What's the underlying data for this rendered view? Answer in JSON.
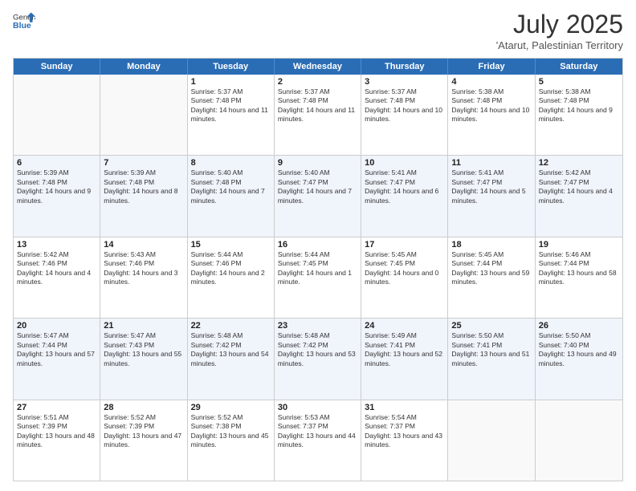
{
  "logo": {
    "general": "General",
    "blue": "Blue"
  },
  "title": "July 2025",
  "location": "'Atarut, Palestinian Territory",
  "days_of_week": [
    "Sunday",
    "Monday",
    "Tuesday",
    "Wednesday",
    "Thursday",
    "Friday",
    "Saturday"
  ],
  "weeks": [
    [
      {
        "day": "",
        "sunrise": "",
        "sunset": "",
        "daylight": ""
      },
      {
        "day": "",
        "sunrise": "",
        "sunset": "",
        "daylight": ""
      },
      {
        "day": "1",
        "sunrise": "Sunrise: 5:37 AM",
        "sunset": "Sunset: 7:48 PM",
        "daylight": "Daylight: 14 hours and 11 minutes."
      },
      {
        "day": "2",
        "sunrise": "Sunrise: 5:37 AM",
        "sunset": "Sunset: 7:48 PM",
        "daylight": "Daylight: 14 hours and 11 minutes."
      },
      {
        "day": "3",
        "sunrise": "Sunrise: 5:37 AM",
        "sunset": "Sunset: 7:48 PM",
        "daylight": "Daylight: 14 hours and 10 minutes."
      },
      {
        "day": "4",
        "sunrise": "Sunrise: 5:38 AM",
        "sunset": "Sunset: 7:48 PM",
        "daylight": "Daylight: 14 hours and 10 minutes."
      },
      {
        "day": "5",
        "sunrise": "Sunrise: 5:38 AM",
        "sunset": "Sunset: 7:48 PM",
        "daylight": "Daylight: 14 hours and 9 minutes."
      }
    ],
    [
      {
        "day": "6",
        "sunrise": "Sunrise: 5:39 AM",
        "sunset": "Sunset: 7:48 PM",
        "daylight": "Daylight: 14 hours and 9 minutes."
      },
      {
        "day": "7",
        "sunrise": "Sunrise: 5:39 AM",
        "sunset": "Sunset: 7:48 PM",
        "daylight": "Daylight: 14 hours and 8 minutes."
      },
      {
        "day": "8",
        "sunrise": "Sunrise: 5:40 AM",
        "sunset": "Sunset: 7:48 PM",
        "daylight": "Daylight: 14 hours and 7 minutes."
      },
      {
        "day": "9",
        "sunrise": "Sunrise: 5:40 AM",
        "sunset": "Sunset: 7:47 PM",
        "daylight": "Daylight: 14 hours and 7 minutes."
      },
      {
        "day": "10",
        "sunrise": "Sunrise: 5:41 AM",
        "sunset": "Sunset: 7:47 PM",
        "daylight": "Daylight: 14 hours and 6 minutes."
      },
      {
        "day": "11",
        "sunrise": "Sunrise: 5:41 AM",
        "sunset": "Sunset: 7:47 PM",
        "daylight": "Daylight: 14 hours and 5 minutes."
      },
      {
        "day": "12",
        "sunrise": "Sunrise: 5:42 AM",
        "sunset": "Sunset: 7:47 PM",
        "daylight": "Daylight: 14 hours and 4 minutes."
      }
    ],
    [
      {
        "day": "13",
        "sunrise": "Sunrise: 5:42 AM",
        "sunset": "Sunset: 7:46 PM",
        "daylight": "Daylight: 14 hours and 4 minutes."
      },
      {
        "day": "14",
        "sunrise": "Sunrise: 5:43 AM",
        "sunset": "Sunset: 7:46 PM",
        "daylight": "Daylight: 14 hours and 3 minutes."
      },
      {
        "day": "15",
        "sunrise": "Sunrise: 5:44 AM",
        "sunset": "Sunset: 7:46 PM",
        "daylight": "Daylight: 14 hours and 2 minutes."
      },
      {
        "day": "16",
        "sunrise": "Sunrise: 5:44 AM",
        "sunset": "Sunset: 7:45 PM",
        "daylight": "Daylight: 14 hours and 1 minute."
      },
      {
        "day": "17",
        "sunrise": "Sunrise: 5:45 AM",
        "sunset": "Sunset: 7:45 PM",
        "daylight": "Daylight: 14 hours and 0 minutes."
      },
      {
        "day": "18",
        "sunrise": "Sunrise: 5:45 AM",
        "sunset": "Sunset: 7:44 PM",
        "daylight": "Daylight: 13 hours and 59 minutes."
      },
      {
        "day": "19",
        "sunrise": "Sunrise: 5:46 AM",
        "sunset": "Sunset: 7:44 PM",
        "daylight": "Daylight: 13 hours and 58 minutes."
      }
    ],
    [
      {
        "day": "20",
        "sunrise": "Sunrise: 5:47 AM",
        "sunset": "Sunset: 7:44 PM",
        "daylight": "Daylight: 13 hours and 57 minutes."
      },
      {
        "day": "21",
        "sunrise": "Sunrise: 5:47 AM",
        "sunset": "Sunset: 7:43 PM",
        "daylight": "Daylight: 13 hours and 55 minutes."
      },
      {
        "day": "22",
        "sunrise": "Sunrise: 5:48 AM",
        "sunset": "Sunset: 7:42 PM",
        "daylight": "Daylight: 13 hours and 54 minutes."
      },
      {
        "day": "23",
        "sunrise": "Sunrise: 5:48 AM",
        "sunset": "Sunset: 7:42 PM",
        "daylight": "Daylight: 13 hours and 53 minutes."
      },
      {
        "day": "24",
        "sunrise": "Sunrise: 5:49 AM",
        "sunset": "Sunset: 7:41 PM",
        "daylight": "Daylight: 13 hours and 52 minutes."
      },
      {
        "day": "25",
        "sunrise": "Sunrise: 5:50 AM",
        "sunset": "Sunset: 7:41 PM",
        "daylight": "Daylight: 13 hours and 51 minutes."
      },
      {
        "day": "26",
        "sunrise": "Sunrise: 5:50 AM",
        "sunset": "Sunset: 7:40 PM",
        "daylight": "Daylight: 13 hours and 49 minutes."
      }
    ],
    [
      {
        "day": "27",
        "sunrise": "Sunrise: 5:51 AM",
        "sunset": "Sunset: 7:39 PM",
        "daylight": "Daylight: 13 hours and 48 minutes."
      },
      {
        "day": "28",
        "sunrise": "Sunrise: 5:52 AM",
        "sunset": "Sunset: 7:39 PM",
        "daylight": "Daylight: 13 hours and 47 minutes."
      },
      {
        "day": "29",
        "sunrise": "Sunrise: 5:52 AM",
        "sunset": "Sunset: 7:38 PM",
        "daylight": "Daylight: 13 hours and 45 minutes."
      },
      {
        "day": "30",
        "sunrise": "Sunrise: 5:53 AM",
        "sunset": "Sunset: 7:37 PM",
        "daylight": "Daylight: 13 hours and 44 minutes."
      },
      {
        "day": "31",
        "sunrise": "Sunrise: 5:54 AM",
        "sunset": "Sunset: 7:37 PM",
        "daylight": "Daylight: 13 hours and 43 minutes."
      },
      {
        "day": "",
        "sunrise": "",
        "sunset": "",
        "daylight": ""
      },
      {
        "day": "",
        "sunrise": "",
        "sunset": "",
        "daylight": ""
      }
    ]
  ]
}
